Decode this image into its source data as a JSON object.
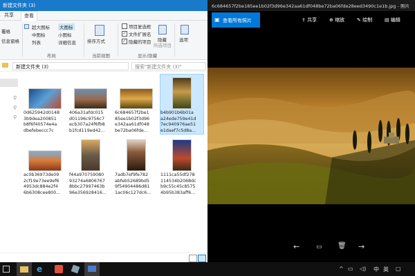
{
  "explorer": {
    "title": "新建文件夹 (3)",
    "tabs": [
      "共享",
      "查看"
    ],
    "ribbon": {
      "left_labels": [
        "覆格",
        "信息窗格"
      ],
      "layout_options": [
        "超大图标",
        "大图标",
        "中图标",
        "小图标",
        "列表",
        "详细信息"
      ],
      "group_layout": "布局",
      "sort_label": "排序方式",
      "group_current_view": "当前视图",
      "checkboxes": [
        {
          "label": "项目复选框",
          "checked": false
        },
        {
          "label": "文件扩展名",
          "checked": true
        },
        {
          "label": "隐藏的项目",
          "checked": true
        }
      ],
      "hide_label": "隐藏",
      "hide_selected_label": "所选项目",
      "options_label": "选项",
      "group_show_hide": "显示/隐藏"
    },
    "address": "新建文件夹 (3)",
    "search_placeholder": "搜索\"新建文件夹 (3)\"",
    "files": [
      {
        "lines": [
          "0d625942d0148",
          "3b9dea200851",
          "b8f6f40574e4a",
          "dbefebeccc7c"
        ],
        "palette": "blue",
        "selected": false
      },
      {
        "lines": [
          "406a31afdc015",
          "d01196c9756c7",
          "ecb307a24f6fb8",
          "b1fcd119ed42..."
        ],
        "palette": "bridge",
        "selected": false
      },
      {
        "lines": [
          "6c684657f2be1",
          "85ee1b02f3d96",
          "e342aa61df048",
          "be72ba06fde..."
        ],
        "palette": "golden",
        "selected": false
      },
      {
        "lines": [
          "b4b901b6b01a",
          "a24ede759e41d",
          "7ec940976ae51",
          "e1daef7c5d8a..."
        ],
        "palette": "portrait",
        "selected": true
      },
      {
        "lines": [
          "ac0b36973de09",
          "2cf19e73ee9ef6",
          "4953dc884e2f4",
          "6b6308cee800..."
        ],
        "palette": "canyon",
        "selected": false
      },
      {
        "lines": [
          "f44a970759080",
          "93274a6806767",
          "8bbc27997463b",
          "96e356928416..."
        ],
        "palette": "rail",
        "selected": false
      },
      {
        "lines": [
          "7adb7ef9fe782",
          "abfeb52689bd5",
          "9f54904486d81",
          "1ac06c127dc6..."
        ],
        "palette": "arch",
        "selected": false
      },
      {
        "lines": [
          "1111ca55df278",
          "114534b2068dc",
          "b9c55c45c8575",
          "4b95b383aff6..."
        ],
        "palette": "mountain",
        "selected": false
      }
    ]
  },
  "viewer": {
    "title": "6c684657f2be185ee1b02f3d96e342aa61df048be72ba06fde28eed3490c1e1b.jpg - 照片",
    "back_label": "查看所有照片",
    "actions": [
      "共享",
      "缩放",
      "绘制",
      "编辑"
    ]
  },
  "taskbar": {
    "ime": "中",
    "lang": "英"
  },
  "colors": {
    "accent": "#0078d7",
    "titlebar": "#1979ca",
    "selection": "#cce8ff"
  }
}
